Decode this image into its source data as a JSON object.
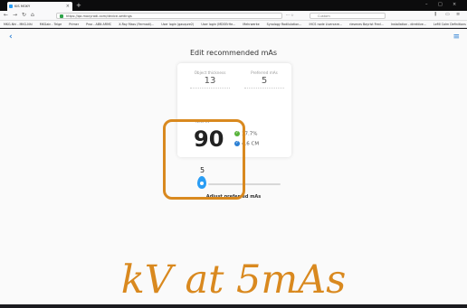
{
  "browser": {
    "tab_title": "KIS MOXY",
    "new_tab": "+",
    "window_controls": [
      "–",
      "□",
      "×"
    ],
    "url": "https://qa.moxyradi.com/device-settings",
    "search_placeholder": "Custom",
    "bookmarks": [
      "MKG-Nhi - MKG-Nhi",
      "MKGain - Telge",
      "Primer",
      "Prox - ABN ARMC",
      "X-Ray Mass (Fermadi)...",
      "User login (gauqure2)",
      "User login (MDOErHe...",
      "Mehrwerke",
      "Synology Radilulation...",
      "IHCS node Livercare...",
      "riesenes Bayrist Fred...",
      "Installation - direktive...",
      "LeMI Calm Definitions"
    ]
  },
  "page": {
    "title": "Edit recommended mAs",
    "object_thickness_label": "Object thickness",
    "object_thickness_value": "13",
    "preferred_mas_label": "Preferred mAs",
    "preferred_mas_value": "5",
    "new_kv_label": "New kV",
    "kv_value": "90",
    "stat1": "17.7%",
    "stat2": "4.6 CM",
    "slider_value": "5",
    "adjust_label": "Adjust preferred mAs",
    "slider_position": 0.0
  },
  "overlay": {
    "caption": "kV at 5mAs",
    "highlight_color": "#d9891f"
  },
  "colors": {
    "accent": "#2a9df4",
    "check": "#58b33a",
    "annotation": "#d9891f"
  }
}
